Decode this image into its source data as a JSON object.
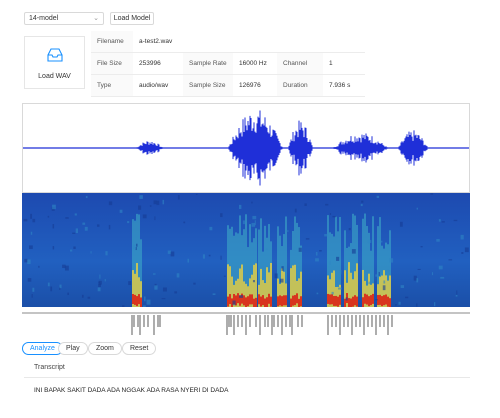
{
  "toolbar": {
    "model_select": "14-model",
    "load_model_label": "Load Model"
  },
  "upload": {
    "label": "Load WAV"
  },
  "info": {
    "filename_key": "Filename",
    "filename_val": "a-test2.wav",
    "filesize_key": "File Size",
    "filesize_val": "253996",
    "samplerate_key": "Sample Rate",
    "samplerate_val": "16000 Hz",
    "channel_key": "Channel",
    "channel_val": "1",
    "type_key": "Type",
    "type_val": "audio/wav",
    "samplesize_key": "Sample Size",
    "samplesize_val": "126976",
    "duration_key": "Duration",
    "duration_val": "7.936 s"
  },
  "controls": {
    "analyze": "Analyze",
    "play": "Play",
    "zoom": "Zoom",
    "reset": "Reset"
  },
  "transcript": {
    "label": "Transcript",
    "text": "INI BAPAK SAKIT DADA ADA NGGAK ADA RASA NYERI DI DADA"
  },
  "colors": {
    "waveform": "#1f2fd8",
    "accent": "#1890ff",
    "spectrogram_base": "#1a3fa0"
  }
}
